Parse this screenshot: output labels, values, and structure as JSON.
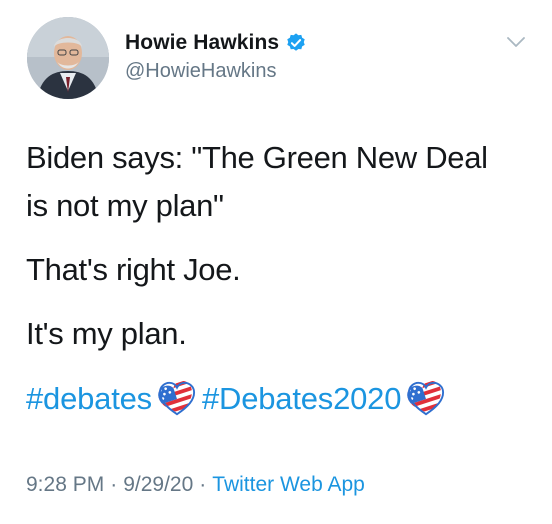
{
  "author": {
    "display_name": "Howie Hawkins",
    "handle": "@HowieHawkins",
    "verified": true
  },
  "tweet": {
    "lines": [
      "Biden says: \"The Green New Deal",
      "is not my plan\"",
      "That's right Joe.",
      "It's my plan."
    ],
    "hashtags": [
      "#debates",
      "#Debates2020"
    ],
    "hashtag_emoji": "heart-icon",
    "time": "9:28 PM",
    "date": "9/29/20",
    "separator": "·",
    "source": "Twitter Web App"
  },
  "colors": {
    "link": "#1b95e0",
    "muted": "#657786",
    "text": "#14171a"
  }
}
